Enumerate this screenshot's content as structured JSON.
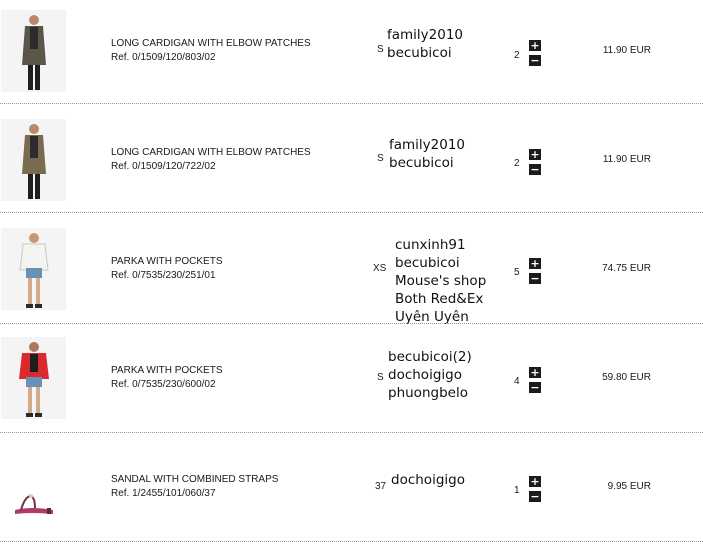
{
  "cart": {
    "items": [
      {
        "name": "LONG CARDIGAN WITH ELBOW PATCHES",
        "ref": "Ref. 0/1509/120/803/02",
        "size": "S",
        "buyers": [
          "family2010",
          "becubicoi"
        ],
        "quantity": "2",
        "price": "11.90 EUR",
        "plus": "+",
        "minus": "−",
        "colors": {
          "garment": "#5a5748",
          "skin": "#d6b49c"
        }
      },
      {
        "name": "LONG CARDIGAN WITH ELBOW PATCHES",
        "ref": "Ref. 0/1509/120/722/02",
        "size": "S",
        "buyers": [
          "family2010",
          "becubicoi"
        ],
        "quantity": "2",
        "price": "11.90 EUR",
        "plus": "+",
        "minus": "−",
        "colors": {
          "garment": "#7a6a50",
          "skin": "#d6b49c"
        }
      },
      {
        "name": "PARKA WITH POCKETS",
        "ref": "Ref. 0/7535/230/251/01",
        "size": "XS",
        "buyers": [
          "cunxinh91",
          "becubicoi",
          "Mouse's shop",
          "Both Red&Ex",
          "Uyên Uyên"
        ],
        "quantity": "5",
        "price": "74.75 EUR",
        "plus": "+",
        "minus": "−",
        "colors": {
          "garment": "#f3f3f0",
          "skin": "#d6b49c"
        }
      },
      {
        "name": "PARKA WITH POCKETS",
        "ref": "Ref. 0/7535/230/600/02",
        "size": "S",
        "buyers": [
          "becubicoi(2)",
          "dochoigigo",
          "phuongbelo"
        ],
        "quantity": "4",
        "price": "59.80 EUR",
        "plus": "+",
        "minus": "−",
        "colors": {
          "garment": "#d82a2f",
          "skin": "#d6b49c"
        }
      },
      {
        "name": "SANDAL WITH COMBINED STRAPS",
        "ref": "Ref. 1/2455/101/060/37",
        "size": "37",
        "buyers": [
          "dochoigigo"
        ],
        "quantity": "1",
        "price": "9.95 EUR",
        "plus": "+",
        "minus": "−",
        "colors": {
          "garment": "#b03a6a",
          "skin": "#d6b49c"
        }
      }
    ]
  }
}
